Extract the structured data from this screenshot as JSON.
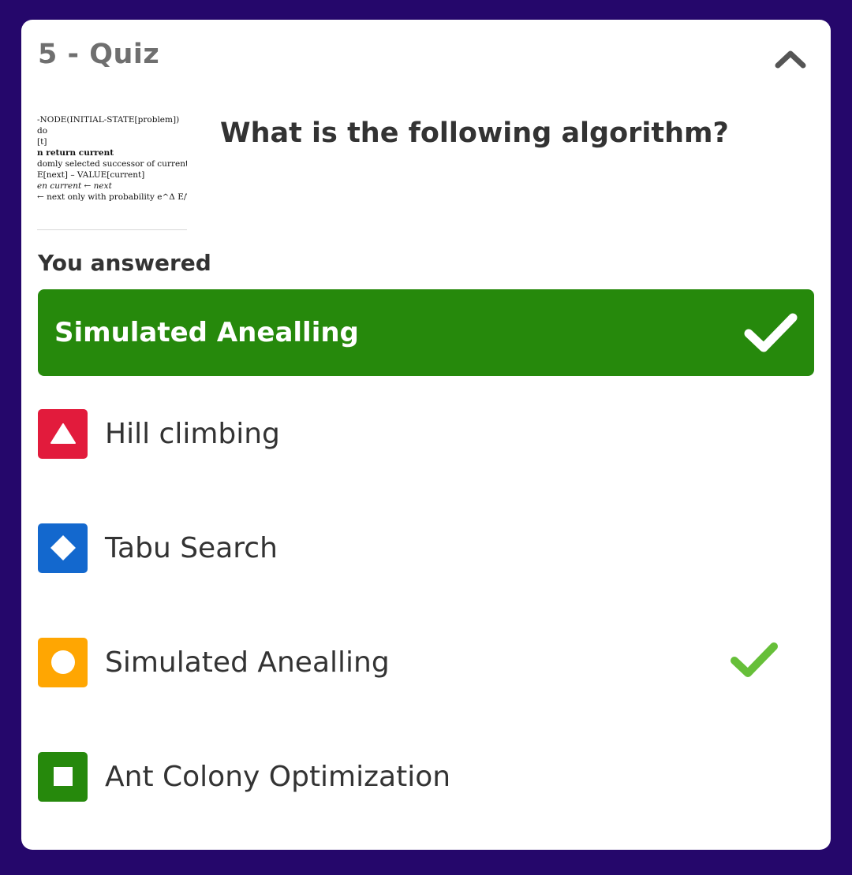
{
  "quiz": {
    "title": "5 - Quiz",
    "collapse_icon": "chevron-up-icon"
  },
  "question": {
    "text": "What is the following algorithm?",
    "image_lines": [
      "-NODE(INITIAL-STATE[problem])",
      "do",
      "[t]",
      "n return current",
      "domly selected successor of current",
      "E[next] – VALUE[current]",
      "en current ← next",
      "← next only with probability e^Δ E/T"
    ]
  },
  "answer": {
    "label": "You answered",
    "value": "Simulated Anealling",
    "icon": "checkmark-icon",
    "color": "#26890c"
  },
  "options": [
    {
      "label": "Hill climbing",
      "shape": "triangle-icon",
      "color": "#e21b3c",
      "correct": false
    },
    {
      "label": "Tabu Search",
      "shape": "diamond-icon",
      "color": "#1368ce",
      "correct": false
    },
    {
      "label": "Simulated Anealling",
      "shape": "circle-icon",
      "color": "#ffa602",
      "correct": true
    },
    {
      "label": "Ant Colony Optimization",
      "shape": "square-icon",
      "color": "#26890c",
      "correct": false
    }
  ],
  "colors": {
    "background": "#25076b",
    "card": "#ffffff",
    "correct_check": "#66bf39"
  }
}
